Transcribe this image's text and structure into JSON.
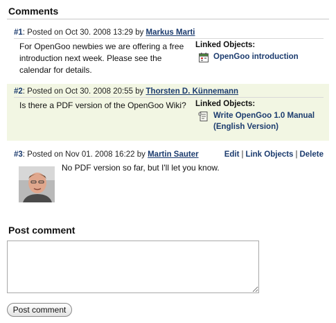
{
  "comments_section": {
    "title": "Comments"
  },
  "comments": [
    {
      "number": "#1",
      "posted_prefix": ": Posted on Oct 30. 2008 13:29 by ",
      "author": "Markus Marti",
      "body": "For OpenGoo newbies we are offering a free introduction next week. Please see the calendar for details.",
      "linked_title": "Linked Objects:",
      "linked_object": {
        "icon": "calendar-icon",
        "label": "OpenGoo introduction"
      }
    },
    {
      "number": "#2",
      "posted_prefix": ": Posted on Oct 30. 2008 20:55 by ",
      "author": "Thorsten D. Künnemann",
      "body": "Is there a PDF version of the OpenGoo Wiki?",
      "linked_title": "Linked Objects:",
      "linked_object": {
        "icon": "task-icon",
        "label": "Write OpenGoo 1.0 Manual (English Version)"
      }
    },
    {
      "number": "#3",
      "posted_prefix": ": Posted on Nov 01. 2008 16:22 by ",
      "author": "Martin Sauter",
      "body": "No PDF version so far, but I'll let you know.",
      "actions": {
        "edit": "Edit",
        "link": "Link Objects",
        "delete": "Delete",
        "separator": "|"
      }
    }
  ],
  "post_section": {
    "title": "Post comment",
    "textarea_value": "",
    "button_label": "Post comment"
  }
}
